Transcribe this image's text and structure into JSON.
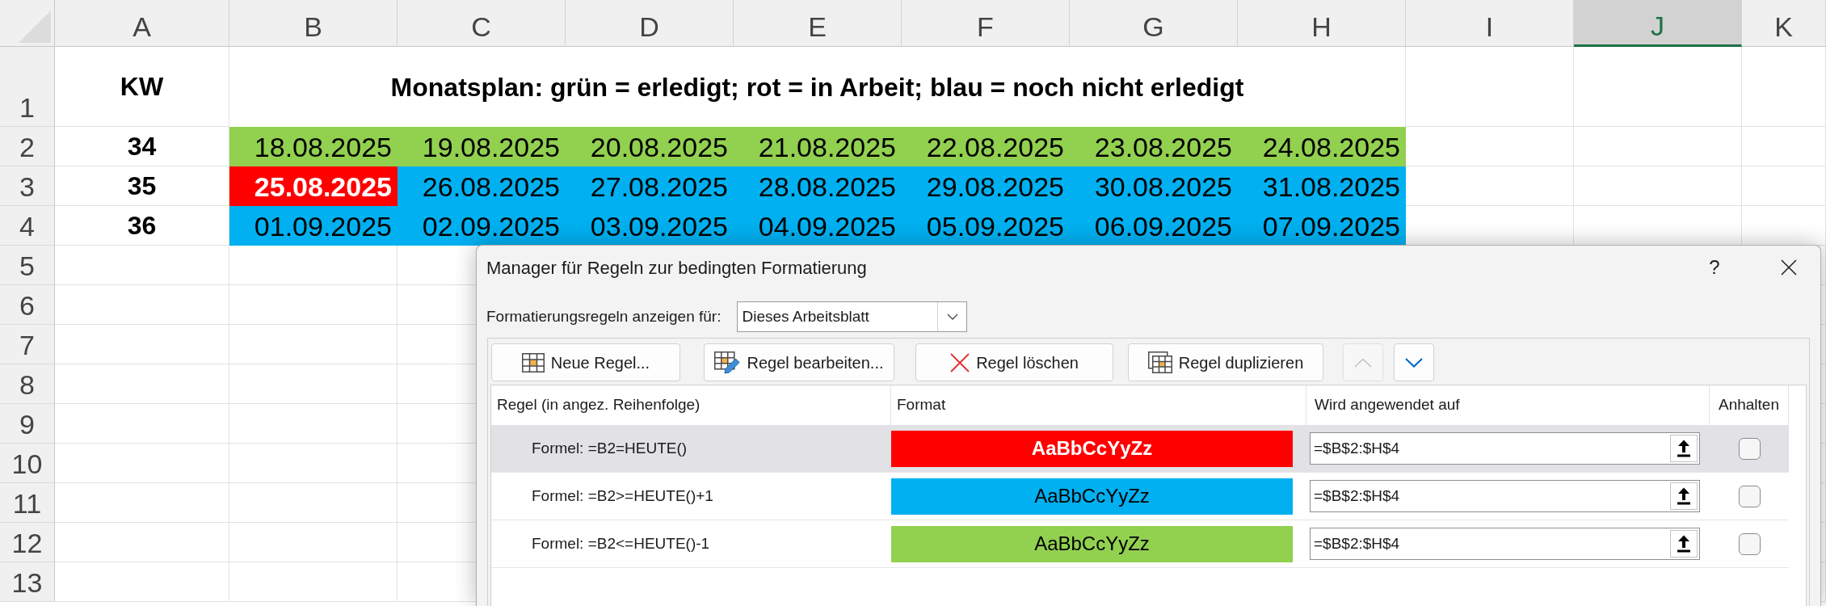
{
  "sheet": {
    "columns": [
      {
        "label": "A",
        "selected": false
      },
      {
        "label": "B",
        "selected": false
      },
      {
        "label": "C",
        "selected": false
      },
      {
        "label": "D",
        "selected": false
      },
      {
        "label": "E",
        "selected": false
      },
      {
        "label": "F",
        "selected": false
      },
      {
        "label": "G",
        "selected": false
      },
      {
        "label": "H",
        "selected": false
      },
      {
        "label": "I",
        "selected": false
      },
      {
        "label": "J",
        "selected": true
      },
      {
        "label": "K",
        "selected": false
      }
    ],
    "row_numbers": [
      "1",
      "2",
      "3",
      "4",
      "5",
      "6",
      "7",
      "8",
      "9",
      "10",
      "11",
      "12",
      "13"
    ],
    "kw_heading": "KW",
    "title": "Monatsplan: grün = erledigt; rot = in Arbeit; blau = noch nicht erledigt",
    "weeks": [
      {
        "kw": "34",
        "days": [
          {
            "date": "18.08.2025",
            "color": "#92d050",
            "emphasis": false
          },
          {
            "date": "19.08.2025",
            "color": "#92d050",
            "emphasis": false
          },
          {
            "date": "20.08.2025",
            "color": "#92d050",
            "emphasis": false
          },
          {
            "date": "21.08.2025",
            "color": "#92d050",
            "emphasis": false
          },
          {
            "date": "22.08.2025",
            "color": "#92d050",
            "emphasis": false
          },
          {
            "date": "23.08.2025",
            "color": "#92d050",
            "emphasis": false
          },
          {
            "date": "24.08.2025",
            "color": "#92d050",
            "emphasis": false
          }
        ]
      },
      {
        "kw": "35",
        "days": [
          {
            "date": "25.08.2025",
            "color": "#ff0000",
            "emphasis": true
          },
          {
            "date": "26.08.2025",
            "color": "#00b0f0",
            "emphasis": false
          },
          {
            "date": "27.08.2025",
            "color": "#00b0f0",
            "emphasis": false
          },
          {
            "date": "28.08.2025",
            "color": "#00b0f0",
            "emphasis": false
          },
          {
            "date": "29.08.2025",
            "color": "#00b0f0",
            "emphasis": false
          },
          {
            "date": "30.08.2025",
            "color": "#00b0f0",
            "emphasis": false
          },
          {
            "date": "31.08.2025",
            "color": "#00b0f0",
            "emphasis": false
          }
        ]
      },
      {
        "kw": "36",
        "days": [
          {
            "date": "01.09.2025",
            "color": "#00b0f0",
            "emphasis": false
          },
          {
            "date": "02.09.2025",
            "color": "#00b0f0",
            "emphasis": false
          },
          {
            "date": "03.09.2025",
            "color": "#00b0f0",
            "emphasis": false
          },
          {
            "date": "04.09.2025",
            "color": "#00b0f0",
            "emphasis": false
          },
          {
            "date": "05.09.2025",
            "color": "#00b0f0",
            "emphasis": false
          },
          {
            "date": "06.09.2025",
            "color": "#00b0f0",
            "emphasis": false
          },
          {
            "date": "07.09.2025",
            "color": "#00b0f0",
            "emphasis": false
          }
        ]
      }
    ]
  },
  "dialog": {
    "title": "Manager für Regeln zur bedingten Formatierung",
    "help": "?",
    "scope_label": "Formatierungsregeln anzeigen für:",
    "scope_value": "Dieses Arbeitsblatt",
    "toolbar": [
      {
        "kind": "new",
        "label": "Neue Regel...",
        "disabled": false
      },
      {
        "kind": "edit",
        "label": "Regel bearbeiten...",
        "disabled": false
      },
      {
        "kind": "delete",
        "label": "Regel löschen",
        "disabled": false
      },
      {
        "kind": "duplicate",
        "label": "Regel duplizieren",
        "disabled": false
      },
      {
        "kind": "move_up",
        "disabled": true
      },
      {
        "kind": "move_down",
        "disabled": false
      }
    ],
    "columns": [
      "Regel (in angez. Reihenfolge)",
      "Format",
      "Wird angewendet auf",
      "Anhalten"
    ],
    "rules": [
      {
        "rule": "Formel: =B2=HEUTE()",
        "preview": "AaBbCcYyZz",
        "color": "#ff0000",
        "emphasis": true,
        "applies_to": "=$B$2:$H$4",
        "stop": false,
        "selected": true
      },
      {
        "rule": "Formel: =B2>=HEUTE()+1",
        "preview": "AaBbCcYyZz",
        "color": "#00b0f0",
        "emphasis": false,
        "applies_to": "=$B$2:$H$4",
        "stop": false,
        "selected": false
      },
      {
        "rule": "Formel: =B2<=HEUTE()-1",
        "preview": "AaBbCcYyZz",
        "color": "#92d050",
        "emphasis": false,
        "applies_to": "=$B$2:$H$4",
        "stop": false,
        "selected": false
      }
    ]
  }
}
